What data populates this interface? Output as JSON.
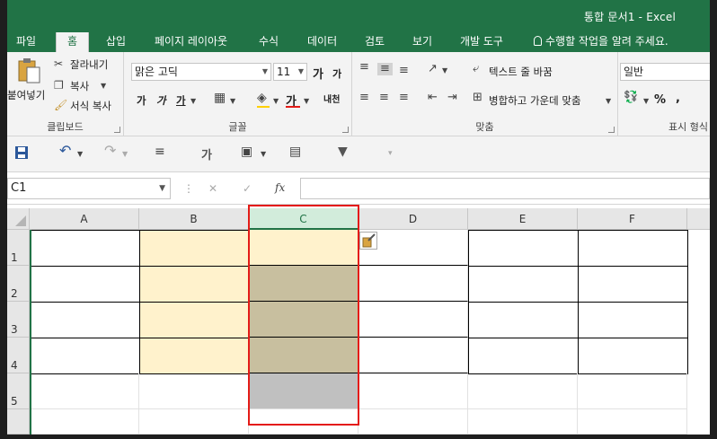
{
  "window": {
    "title": "통합 문서1 - Excel"
  },
  "tabs": [
    {
      "label": "파일"
    },
    {
      "label": "홈"
    },
    {
      "label": "삽입"
    },
    {
      "label": "페이지 레이아웃"
    },
    {
      "label": "수식"
    },
    {
      "label": "데이터"
    },
    {
      "label": "검토"
    },
    {
      "label": "보기"
    },
    {
      "label": "개발 도구"
    },
    {
      "label": "수행할 작업을 알려 주세요."
    }
  ],
  "ribbon": {
    "clipboard": {
      "label": "클립보드",
      "paste": "붙여넣기",
      "cut": "잘라내기",
      "copy": "복사",
      "format_painter": "서식 복사"
    },
    "font": {
      "label": "글꼴",
      "font_name": "맑은 고딕",
      "font_size": "11",
      "grow": "가",
      "shrink": "가",
      "bold": "가",
      "italic": "가",
      "underline": "가",
      "font_color": "가",
      "phonetic": "내천"
    },
    "alignment": {
      "label": "맞춤",
      "wrap_text": "텍스트 줄 바꿈",
      "merge_center": "병합하고 가운데 맞춤"
    },
    "number": {
      "label": "표시 형식",
      "format": "일반",
      "percent": "%",
      "comma": ","
    }
  },
  "qat": {
    "sort_icon": "가"
  },
  "formula_bar": {
    "name_box": "C1",
    "fx": "fx",
    "cancel": "✕",
    "enter": "✓"
  },
  "sheet": {
    "columns": [
      "A",
      "B",
      "C",
      "D",
      "E",
      "F"
    ],
    "rows": [
      "1",
      "2",
      "3",
      "4",
      "5"
    ],
    "selected_column": "C"
  },
  "colors": {
    "excel_green": "#217346",
    "cream_fill": "#fff2cc",
    "tan_fill": "#c8bf9f",
    "gray_fill": "#c0c0c0",
    "selection_red": "#e41b17"
  }
}
